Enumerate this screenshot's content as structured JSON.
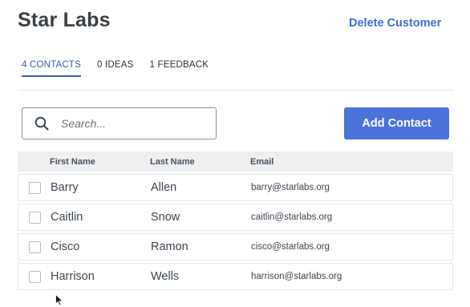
{
  "header": {
    "title": "Star Labs",
    "delete_label": "Delete Customer"
  },
  "tabs": [
    {
      "label": "4 CONTACTS",
      "active": true
    },
    {
      "label": "0 IDEAS",
      "active": false
    },
    {
      "label": "1 FEEDBACK",
      "active": false
    }
  ],
  "toolbar": {
    "search_placeholder": "Search...",
    "search_icon": "search-icon",
    "add_label": "Add Contact"
  },
  "table": {
    "columns": [
      "First Name",
      "Last Name",
      "Email"
    ],
    "rows": [
      {
        "first": "Barry",
        "last": "Allen",
        "email": "barry@starlabs.org"
      },
      {
        "first": "Caitlin",
        "last": "Snow",
        "email": "caitlin@starlabs.org"
      },
      {
        "first": "Cisco",
        "last": "Ramon",
        "email": "cisco@starlabs.org"
      },
      {
        "first": "Harrison",
        "last": "Wells",
        "email": "harrison@starlabs.org"
      }
    ]
  },
  "colors": {
    "accent": "#4a74dc",
    "link": "#3b6fd6",
    "active_tab": "#3b5ba8",
    "header_bg": "#eeeff1"
  }
}
